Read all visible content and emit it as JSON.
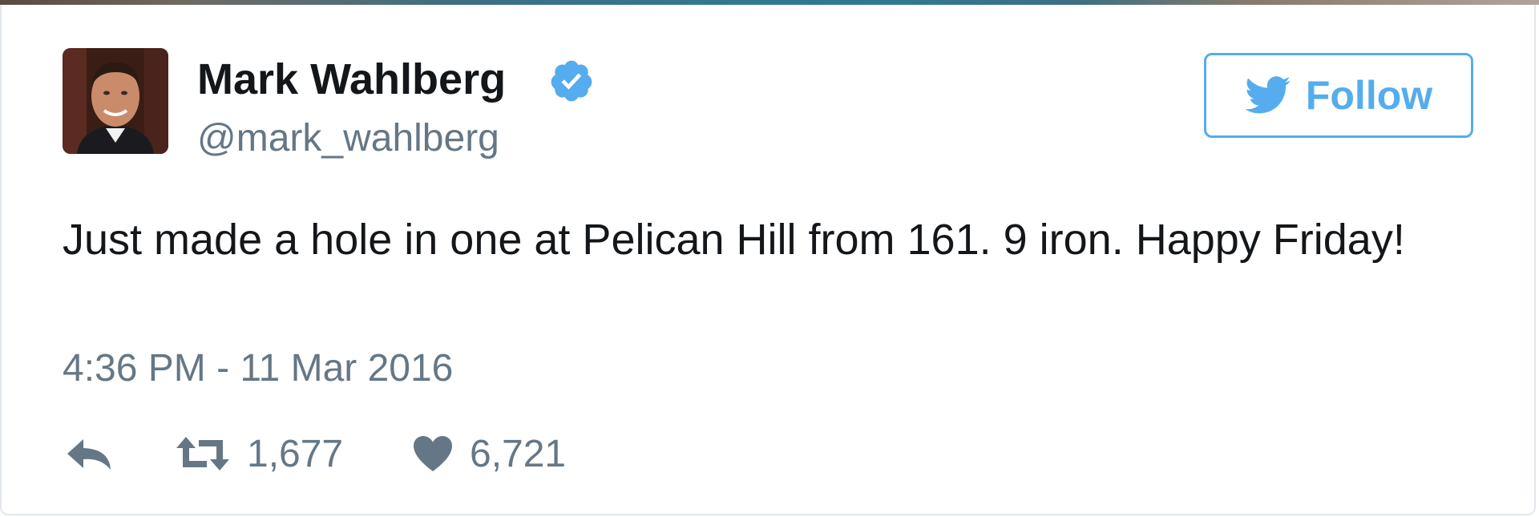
{
  "tweet": {
    "author_name": "Mark Wahlberg",
    "author_handle": "@mark_wahlberg",
    "verified": true,
    "text": "Just made a hole in one at Pelican Hill from 161. 9 iron. Happy Friday!",
    "timestamp": "4:36 PM - 11 Mar 2016",
    "follow_label": "Follow",
    "retweet_count": "1,677",
    "like_count": "6,721"
  },
  "icons": {
    "avatar": "profile-photo",
    "verified": "verified-badge-icon",
    "follow": "twitter-bird-icon",
    "reply": "reply-icon",
    "retweet": "retweet-icon",
    "like": "heart-icon"
  },
  "colors": {
    "accent": "#55acee",
    "text": "#14171a",
    "muted": "#657786",
    "border": "#e1e8ed"
  }
}
